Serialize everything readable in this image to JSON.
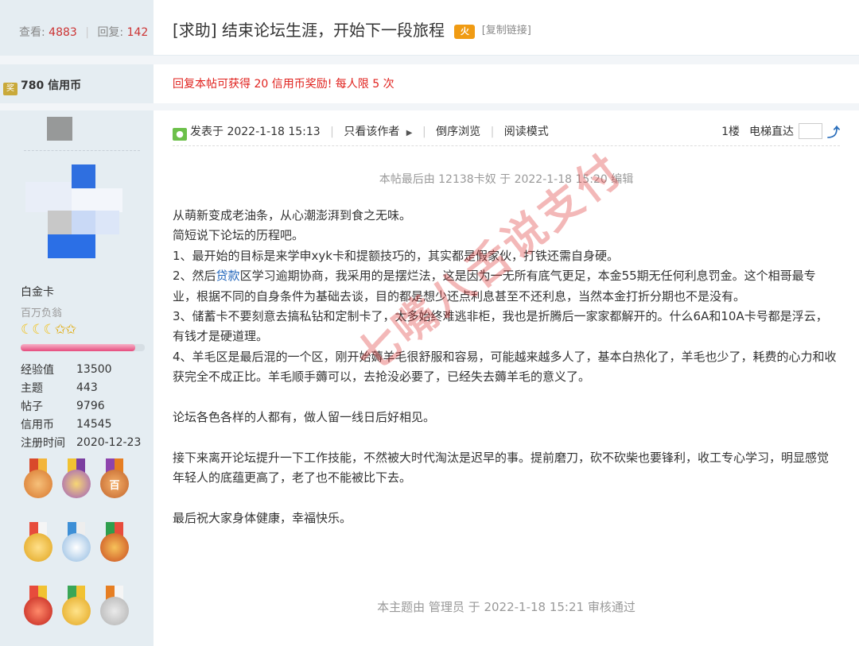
{
  "stats": {
    "views_label": "查看:",
    "views": "4883",
    "separator": "|",
    "replies_label": "回复:",
    "replies": "142"
  },
  "thread": {
    "title": "[求助] 结束论坛生涯，开始下一段旅程",
    "badge": "火",
    "copy_link": "[复制链接]"
  },
  "credit": {
    "icon": "奖",
    "amount": "780 信用币"
  },
  "reward": {
    "text": "回复本帖可获得 20 信用币奖励! 每人限 5 次"
  },
  "user": {
    "group": "白金卡",
    "rank": "百万负翁",
    "level_progress": 0.92,
    "stats": [
      {
        "key": "经验值",
        "value": "13500"
      },
      {
        "key": "主题",
        "value": "443"
      },
      {
        "key": "帖子",
        "value": "9796"
      },
      {
        "key": "信用币",
        "value": "14545"
      },
      {
        "key": "注册时间",
        "value": "2020-12-23"
      }
    ],
    "medal_text": {
      "hundred": "百"
    }
  },
  "post": {
    "posted_at": "发表于 2022-1-18 15:13",
    "only_author": "只看该作者",
    "reverse": "倒序浏览",
    "read_mode": "阅读模式",
    "floor": "1楼",
    "jump": "电梯直达",
    "edit_note": "本帖最后由 12138卡奴 于 2022-1-18 15:20 编辑",
    "lines": {
      "l1": "从萌新变成老油条，从心潮澎湃到食之无味。",
      "l2": "简短说下论坛的历程吧。",
      "l3": "1、最开始的目标是来学申xyk卡和提额技巧的，其实都是假家伙，打铁还需自身硬。",
      "l4a": "2、然后",
      "l4link": "贷款",
      "l4b": "区学习逾期协商，我采用的是摆烂法，这是因为一无所有底气更足，本金55期无任何利息罚金。这个相哥最专业，根据不同的自身条件为基础去谈，目的都是想少还点利息甚至不还利息，当然本金打折分期也不是没有。",
      "l5": "3、储蓄卡不要刻意去搞私钻和定制卡了，太多始终难逃非柜，我也是折腾后一家家都解开的。什么6A和10A卡号都是浮云，有钱才是硬道理。",
      "l6": "4、羊毛区是最后混的一个区，刚开始薅羊毛很舒服和容易，可能越来越多人了，基本白热化了，羊毛也少了，耗费的心力和收获完全不成正比。羊毛顺手薅可以，去抢没必要了，已经失去薅羊毛的意义了。",
      "l7": "论坛各色各样的人都有，做人留一线日后好相见。",
      "l8": "接下来离开论坛提升一下工作技能，不然被大时代淘汰是迟早的事。提前磨刀，砍不砍柴也要锋利，收工专心学习，明显感觉年轻人的底蕴更高了，老了也不能被比下去。",
      "l9": "最后祝大家身体健康，幸福快乐。"
    },
    "watermark": "七嘴八舌说支付",
    "approval": "本主题由 管理员 于 2022-1-18 15:21 审核通过"
  },
  "colors": {
    "sidebar_bg": "#e5edf2",
    "accent_red": "#c33",
    "reward_red": "#e0211d",
    "link_blue": "#2266bb"
  }
}
